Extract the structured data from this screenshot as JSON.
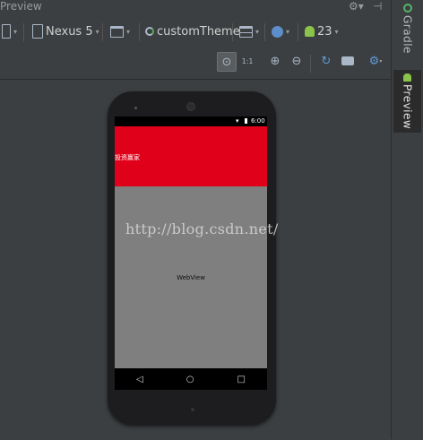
{
  "panel": {
    "title": "Preview"
  },
  "toolbar": {
    "device": "Nexus 5",
    "theme": "customTheme",
    "api_level": "23"
  },
  "sidebar": {
    "gradle_label": "Gradle",
    "preview_label": "Preview"
  },
  "device_screen": {
    "status_time": "6:00",
    "app_title": "投资赢家",
    "webview_label": "WebView",
    "accent_color": "#e0001a",
    "nav": {
      "back": "◁",
      "home": "○",
      "recents": "□"
    }
  },
  "watermark": "http://blog.csdn.net/",
  "icons": {
    "settings": "gear-icon",
    "hide": "pin-icon",
    "zoom_actual": "zoom-actual-icon",
    "zoom_fit": "zoom-fit-icon",
    "zoom_in": "zoom-in-icon",
    "zoom_out": "zoom-out-icon",
    "refresh": "refresh-icon",
    "screenshot": "camera-icon",
    "options": "gear-icon"
  }
}
